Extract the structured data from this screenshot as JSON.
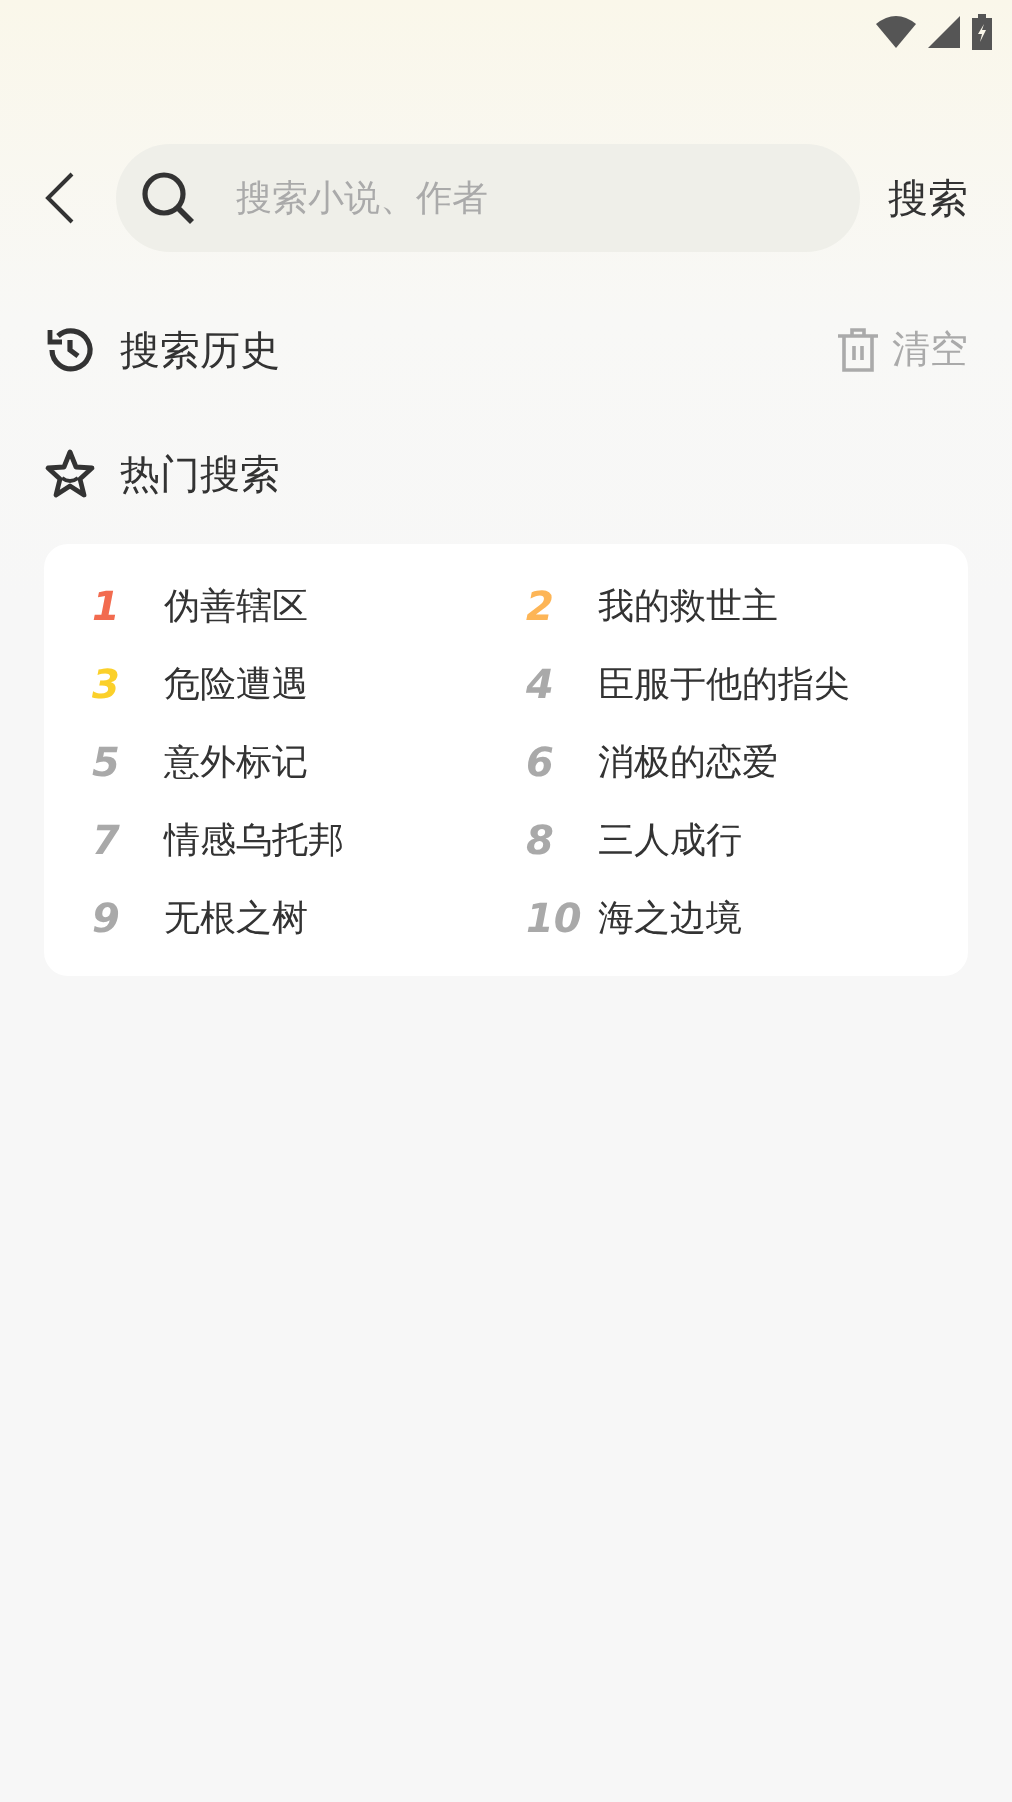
{
  "search": {
    "placeholder": "搜索小说、作者",
    "button": "搜索"
  },
  "history": {
    "title": "搜索历史",
    "clear": "清空"
  },
  "hot": {
    "title": "热门搜索",
    "items": [
      {
        "rank": "1",
        "title": "伪善辖区",
        "color": "#f26b4f"
      },
      {
        "rank": "2",
        "title": "我的救世主",
        "color": "#fdb556"
      },
      {
        "rank": "3",
        "title": "危险遭遇",
        "color": "#fbd02a"
      },
      {
        "rank": "4",
        "title": "臣服于他的指尖",
        "color": "#a9a9a9"
      },
      {
        "rank": "5",
        "title": "意外标记",
        "color": "#a9a9a9"
      },
      {
        "rank": "6",
        "title": "消极的恋爱",
        "color": "#a9a9a9"
      },
      {
        "rank": "7",
        "title": "情感乌托邦",
        "color": "#a9a9a9"
      },
      {
        "rank": "8",
        "title": "三人成行",
        "color": "#a9a9a9"
      },
      {
        "rank": "9",
        "title": "无根之树",
        "color": "#a9a9a9"
      },
      {
        "rank": "10",
        "title": "海之边境",
        "color": "#a9a9a9"
      }
    ]
  }
}
